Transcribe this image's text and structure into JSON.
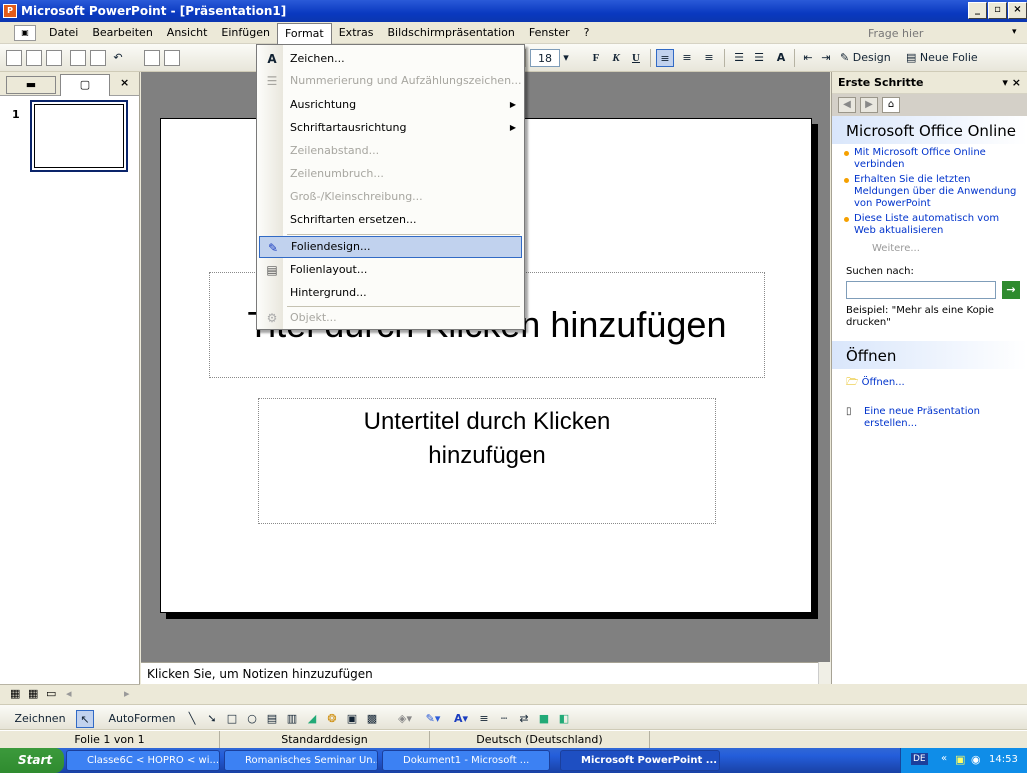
{
  "window": {
    "title": "Microsoft PowerPoint - [Präsentation1]"
  },
  "menubar": {
    "items": [
      "Datei",
      "Bearbeiten",
      "Ansicht",
      "Einfügen",
      "Format",
      "Extras",
      "Bildschirmpräsentation",
      "Fenster",
      "?"
    ],
    "help_placeholder": "Frage hier eingeben"
  },
  "toolbar": {
    "font_size": "18",
    "bold": "F",
    "italic": "K",
    "underline": "U",
    "design_label": "Design",
    "new_slide_label": "Neue Folie"
  },
  "format_menu": {
    "items": [
      {
        "label": "Zeichen...",
        "enabled": true
      },
      {
        "label": "Nummerierung und Aufzählungszeichen...",
        "enabled": false
      },
      {
        "label": "Ausrichtung",
        "enabled": true,
        "submenu": true
      },
      {
        "label": "Schriftartausrichtung",
        "enabled": true,
        "submenu": true
      },
      {
        "label": "Zeilenabstand...",
        "enabled": false
      },
      {
        "label": "Zeilenumbruch...",
        "enabled": false
      },
      {
        "label": "Groß-/Kleinschreibung...",
        "enabled": false
      },
      {
        "label": "Schriftarten ersetzen...",
        "enabled": true
      },
      {
        "label": "Foliendesign...",
        "enabled": true,
        "highlighted": true
      },
      {
        "label": "Folienlayout...",
        "enabled": true
      },
      {
        "label": "Hintergrund...",
        "enabled": true
      },
      {
        "label": "Objekt...",
        "enabled": false
      }
    ]
  },
  "slide_panel": {
    "slide_number": "1"
  },
  "slide": {
    "title_placeholder": "Titel durch Klicken hinzufügen",
    "subtitle_placeholder": "Untertitel durch Klicken hinzufügen"
  },
  "notes": {
    "placeholder": "Klicken Sie, um Notizen hinzuzufügen"
  },
  "task_pane": {
    "header": "Erste Schritte",
    "online_title": "Microsoft Office Online",
    "links": [
      "Mit Microsoft Office Online verbinden",
      "Erhalten Sie die letzten Meldungen über die Anwendung von PowerPoint",
      "Diese Liste automatisch vom Web aktualisieren"
    ],
    "more": "Weitere...",
    "search_label": "Suchen nach:",
    "example": "Beispiel: \"Mehr als eine Kopie drucken\"",
    "open_title": "Öffnen",
    "open_link": "Öffnen...",
    "new_link": "Eine neue Präsentation erstellen..."
  },
  "drawbar": {
    "draw_label": "Zeichnen",
    "autoshapes_label": "AutoFormen"
  },
  "statusbar": {
    "slide": "Folie 1 von 1",
    "design": "Standarddesign",
    "language": "Deutsch (Deutschland)"
  },
  "taskbar": {
    "start": "Start",
    "buttons": [
      "Classe6C < HOPRO < wi...",
      "Romanisches Seminar Un...",
      "Dokument1 - Microsoft ...",
      "Microsoft PowerPoint ..."
    ],
    "lang": "DE",
    "clock": "14:53"
  },
  "colors": {
    "accent": "#316ac5",
    "titlebar": "#0a39c0",
    "taskbar": "#245edb"
  }
}
